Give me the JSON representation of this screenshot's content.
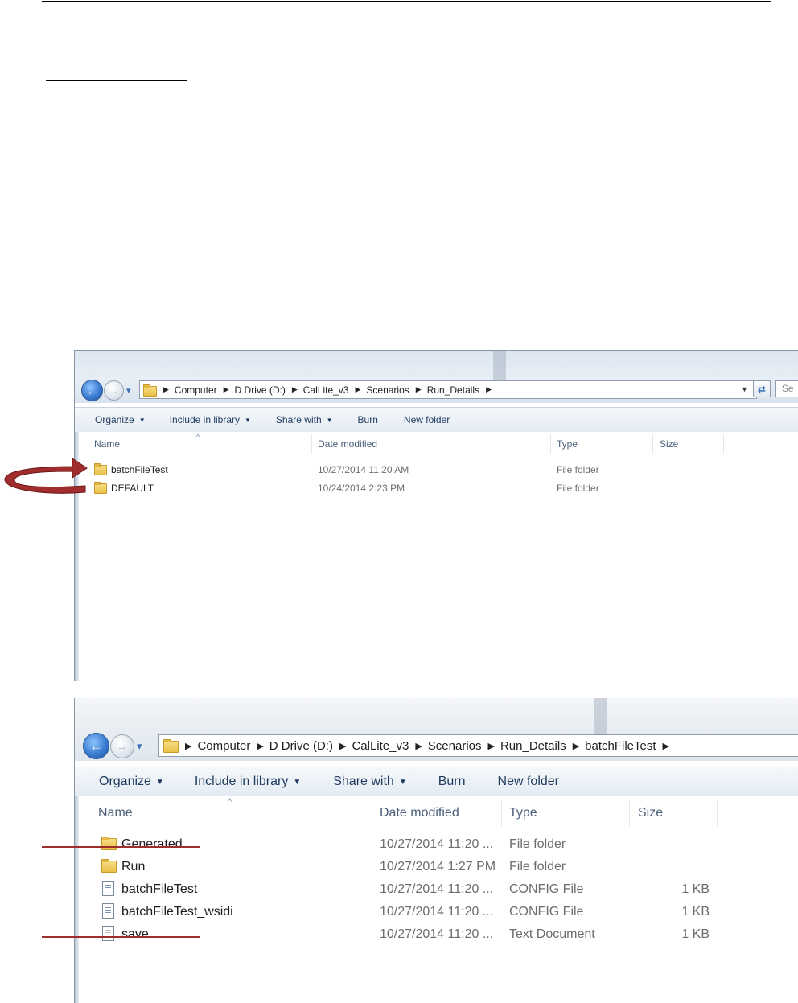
{
  "window_top": {
    "nav": {
      "back_glyph": "←",
      "forward_glyph": "→",
      "recent_glyph": "▾"
    },
    "breadcrumb": [
      "Computer",
      "D Drive (D:)",
      "CalLite_v3",
      "Scenarios",
      "Run_Details"
    ],
    "search_text": "Se",
    "toolbar": {
      "organize": "Organize",
      "include_in_library": "Include in library",
      "share_with": "Share with",
      "burn": "Burn",
      "new_folder": "New folder"
    },
    "columns": {
      "name": "Name",
      "date_modified": "Date modified",
      "type": "Type",
      "size": "Size"
    },
    "rows": [
      {
        "name": "batchFileTest",
        "date": "10/27/2014 11:20 AM",
        "type": "File folder",
        "size": "",
        "icon": "folder-icon"
      },
      {
        "name": "DEFAULT",
        "date": "10/24/2014 2:23 PM",
        "type": "File folder",
        "size": "",
        "icon": "folder-icon"
      }
    ]
  },
  "window_bottom": {
    "nav": {
      "back_glyph": "←",
      "forward_glyph": "→",
      "recent_glyph": "▾"
    },
    "breadcrumb": [
      "Computer",
      "D Drive (D:)",
      "CalLite_v3",
      "Scenarios",
      "Run_Details",
      "batchFileTest"
    ],
    "toolbar": {
      "organize": "Organize",
      "include_in_library": "Include in library",
      "share_with": "Share with",
      "burn": "Burn",
      "new_folder": "New folder"
    },
    "columns": {
      "name": "Name",
      "date_modified": "Date modified",
      "type": "Type",
      "size": "Size"
    },
    "rows": [
      {
        "name": "Generated",
        "date": "10/27/2014 11:20 ...",
        "type": "File folder",
        "size": "",
        "icon": "folder-icon"
      },
      {
        "name": "Run",
        "date": "10/27/2014 1:27 PM",
        "type": "File folder",
        "size": "",
        "icon": "folder-icon"
      },
      {
        "name": "batchFileTest",
        "date": "10/27/2014 11:20 ...",
        "type": "CONFIG File",
        "size": "1 KB",
        "icon": "config-file-icon"
      },
      {
        "name": "batchFileTest_wsidi",
        "date": "10/27/2014 11:20 ...",
        "type": "CONFIG File",
        "size": "1 KB",
        "icon": "config-file-icon"
      },
      {
        "name": "save",
        "date": "10/27/2014 11:20 ...",
        "type": "Text Document",
        "size": "1 KB",
        "icon": "text-file-icon"
      }
    ]
  },
  "annotations": {
    "arrow_color": "#a02c2c",
    "marker_color": "#a02c2c"
  }
}
